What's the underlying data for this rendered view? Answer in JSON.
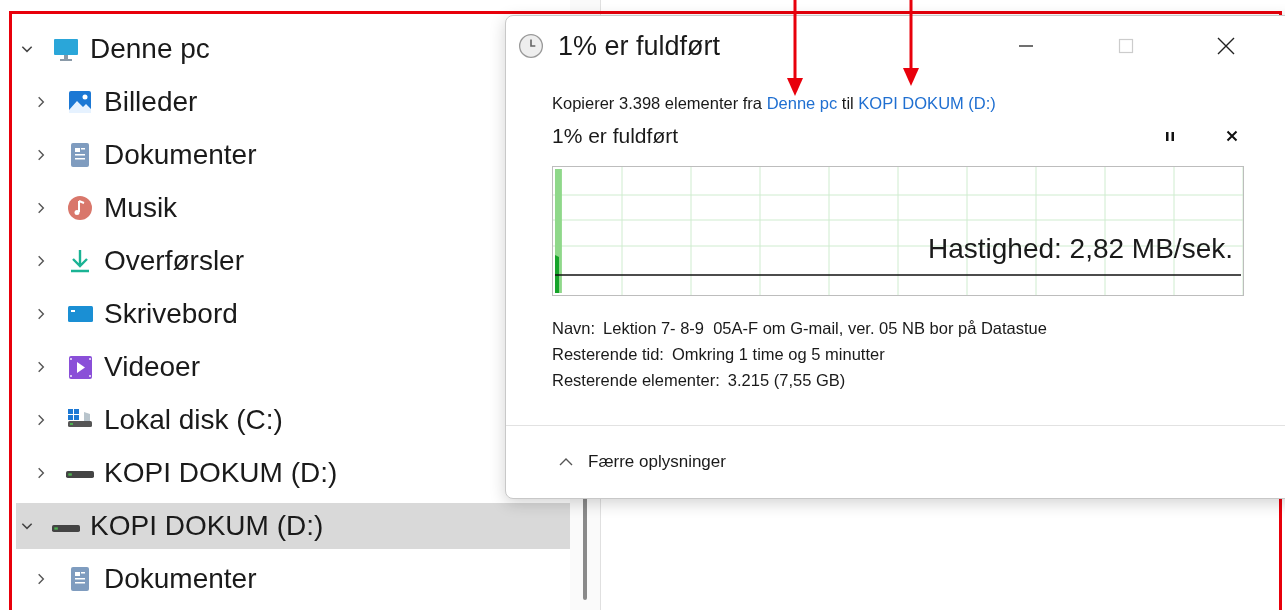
{
  "tree": [
    {
      "label": "Denne pc",
      "kind": "pc",
      "expanded": true,
      "selected": false,
      "children": [
        {
          "label": "Billeder",
          "kind": "pictures",
          "expanded": false,
          "selected": false
        },
        {
          "label": "Dokumenter",
          "kind": "documents",
          "expanded": false,
          "selected": false
        },
        {
          "label": "Musik",
          "kind": "music",
          "expanded": false,
          "selected": false
        },
        {
          "label": "Overførsler",
          "kind": "downloads",
          "expanded": false,
          "selected": false
        },
        {
          "label": "Skrivebord",
          "kind": "desktop",
          "expanded": false,
          "selected": false
        },
        {
          "label": "Videoer",
          "kind": "videos",
          "expanded": false,
          "selected": false
        },
        {
          "label": "Lokal disk (C:)",
          "kind": "disk",
          "expanded": false,
          "selected": false
        },
        {
          "label": "KOPI DOKUM (D:)",
          "kind": "drive",
          "expanded": false,
          "selected": false
        }
      ]
    },
    {
      "label": "KOPI DOKUM (D:)",
      "kind": "drive",
      "expanded": true,
      "selected": true,
      "children": [
        {
          "label": "Dokumenter",
          "kind": "documents",
          "expanded": false,
          "selected": false
        }
      ]
    }
  ],
  "dialog": {
    "title": "1% er fuldført",
    "maximize_disabled": true,
    "summary": {
      "prefix": "Kopierer 3.398 elementer fra",
      "source": "Denne pc",
      "middle": "til",
      "destination": "KOPI DOKUM (D:)"
    },
    "status": "1% er fuldført",
    "progress": {
      "level": 0.01
    },
    "speed": "Hastighed: 2,82 MB/sek.",
    "details": [
      {
        "label": "Navn:",
        "value": "Lektion 7- 8-9  05A-F om G-mail, ver. 05 NB bor på Datastue"
      },
      {
        "label": "Resterende tid:",
        "value": "Omkring 1 time og 5 minutter"
      },
      {
        "label": "Resterende elementer:",
        "value": "3.215 (7,55 GB)"
      }
    ],
    "toggle": "Færre oplysninger"
  }
}
